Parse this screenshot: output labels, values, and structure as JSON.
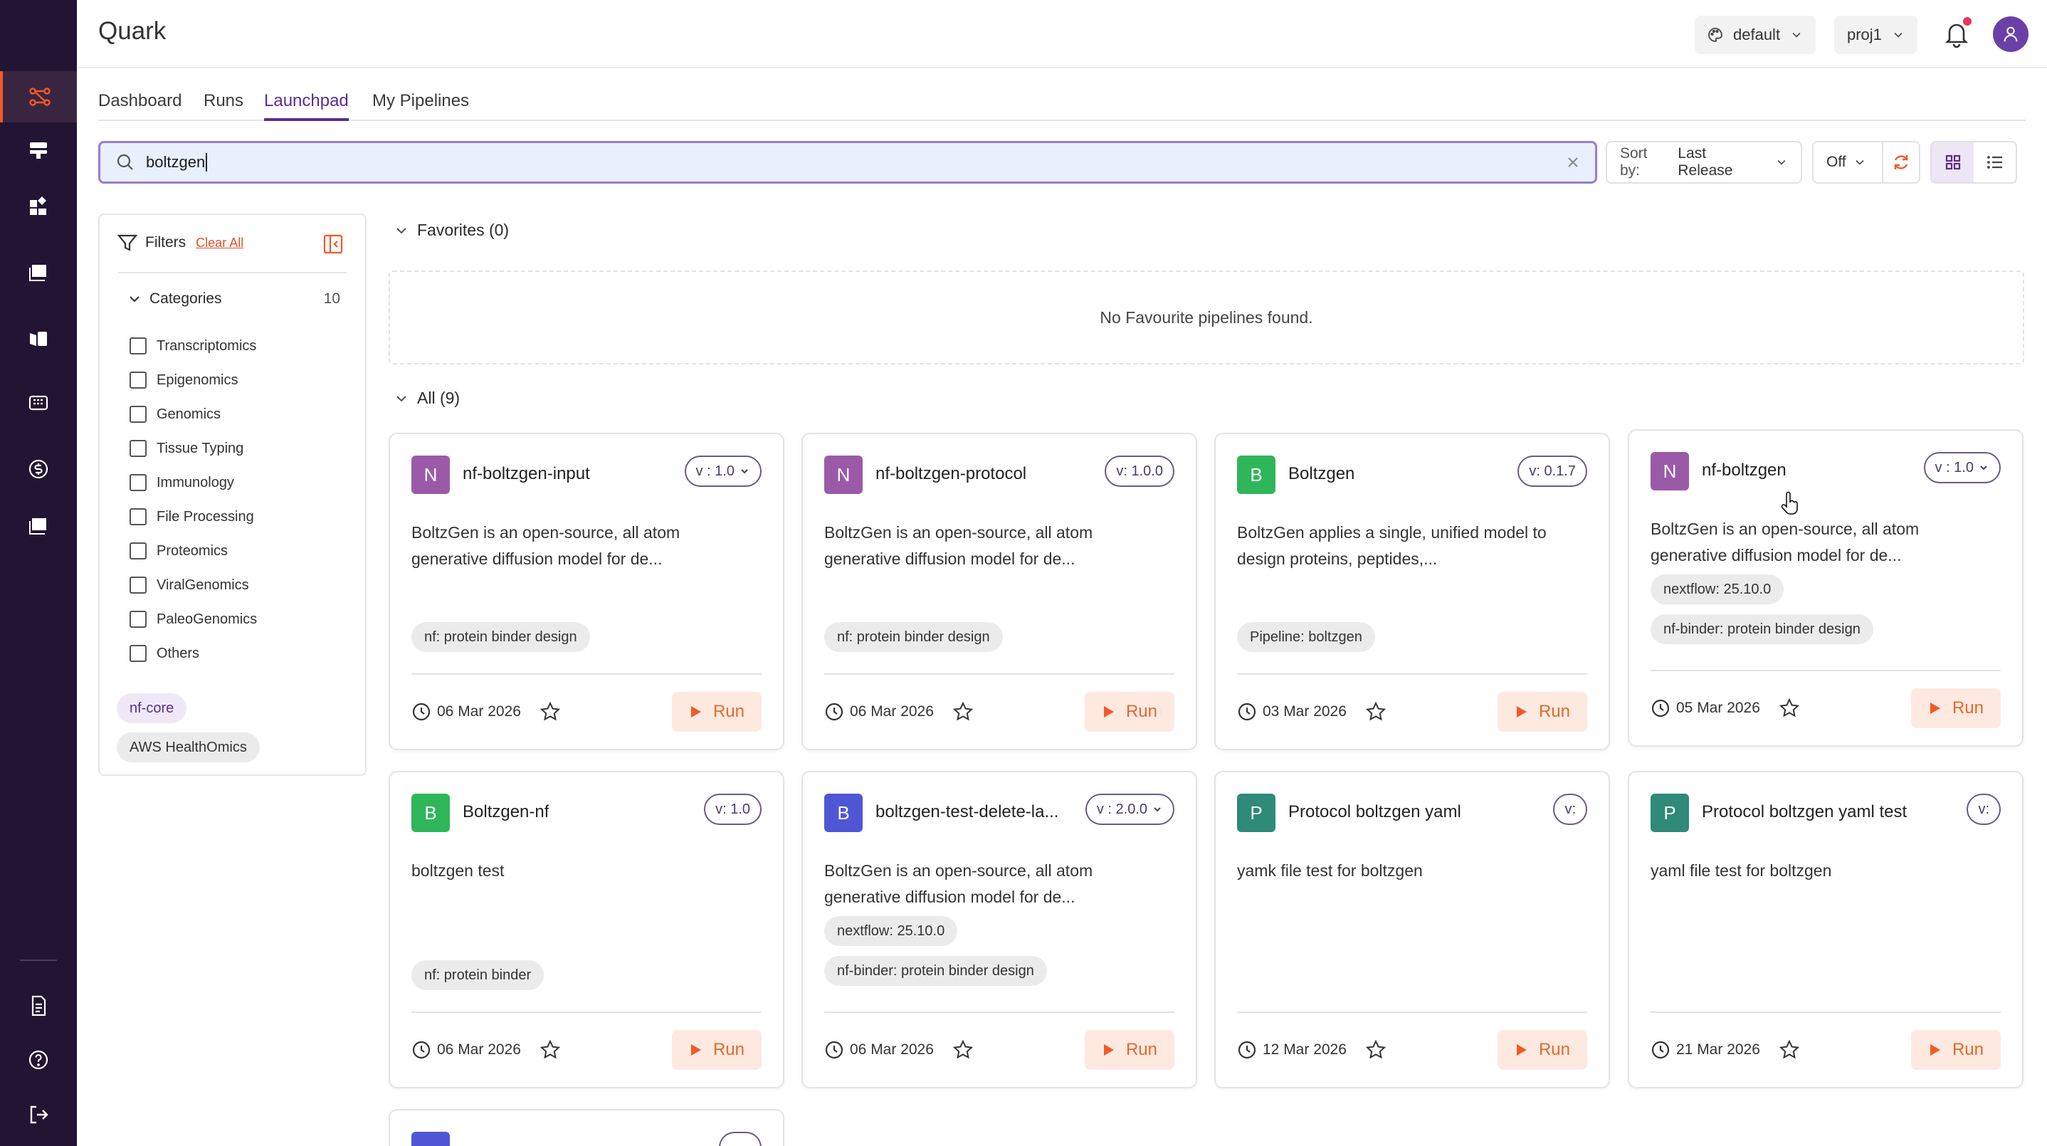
{
  "app": {
    "title": "Quark"
  },
  "header": {
    "env_label": "default",
    "project_label": "proj1"
  },
  "tabs": [
    {
      "label": "Dashboard"
    },
    {
      "label": "Runs"
    },
    {
      "label": "Launchpad",
      "active": true
    },
    {
      "label": "My Pipelines"
    }
  ],
  "search": {
    "value": "boltzgen"
  },
  "controls": {
    "sort_prefix": "Sort by:",
    "sort_value": "Last Release",
    "toggle_value": "Off"
  },
  "filters": {
    "title": "Filters",
    "clear_label": "Clear All",
    "categories_label": "Categories",
    "categories_count": "10",
    "categories": [
      "Transcriptomics",
      "Epigenomics",
      "Genomics",
      "Tissue Typing",
      "Immunology",
      "File Processing",
      "Proteomics",
      "ViralGenomics",
      "PaleoGenomics",
      "Others"
    ],
    "chips": [
      "nf-core",
      "AWS HealthOmics"
    ]
  },
  "favorites": {
    "heading": "Favorites (0)",
    "empty_text": "No Favourite pipelines found."
  },
  "all": {
    "heading": "All (9)"
  },
  "run_label": "Run",
  "cards": [
    {
      "letter": "N",
      "name": "nf-boltzgen-input",
      "version": "v : 1.0",
      "version_dropdown": true,
      "desc": "BoltzGen is an open-source, all atom generative diffusion model for de...",
      "tags": [
        "nf: protein binder design"
      ],
      "date": "06 Mar 2026",
      "badge_color": "#9b5aa8"
    },
    {
      "letter": "N",
      "name": "nf-boltzgen-protocol",
      "version": "v: 1.0.0",
      "version_dropdown": false,
      "desc": "BoltzGen is an open-source, all atom generative diffusion model for de...",
      "tags": [
        "nf: protein binder design"
      ],
      "date": "06 Mar 2026",
      "badge_color": "#9b5aa8"
    },
    {
      "letter": "B",
      "name": "Boltzgen",
      "version": "v: 0.1.7",
      "version_dropdown": false,
      "desc": "BoltzGen applies a single, unified model to design proteins, peptides,...",
      "tags": [
        "Pipeline: boltzgen"
      ],
      "date": "03 Mar 2026",
      "badge_color": "#2fb65a"
    },
    {
      "letter": "N",
      "name": "nf-boltzgen",
      "version": "v : 1.0",
      "version_dropdown": true,
      "desc": "BoltzGen is an open-source, all atom generative diffusion model for de...",
      "tags": [
        "nextflow: 25.10.0",
        "nf-binder: protein binder design"
      ],
      "date": "05 Mar 2026",
      "badge_color": "#9b5aa8"
    },
    {
      "letter": "B",
      "name": "Boltzgen-nf",
      "version": "v: 1.0",
      "version_dropdown": false,
      "desc": "boltzgen test",
      "tags": [
        "nf: protein binder"
      ],
      "date": "06 Mar 2026",
      "badge_color": "#2fb65a"
    },
    {
      "letter": "B",
      "name": "boltzgen-test-delete-la...",
      "version": "v : 2.0.0",
      "version_dropdown": true,
      "desc": "BoltzGen is an open-source, all atom generative diffusion model for de...",
      "tags": [
        "nextflow: 25.10.0",
        "nf-binder: protein binder design"
      ],
      "date": "06 Mar 2026",
      "badge_color": "#4f56d6"
    },
    {
      "letter": "P",
      "name": "Protocol boltzgen yaml",
      "version": "v:",
      "version_dropdown": false,
      "desc": "yamk file test for boltzgen",
      "tags": [],
      "date": "12 Mar 2026",
      "badge_color": "#2f8a78"
    },
    {
      "letter": "P",
      "name": "Protocol boltzgen yaml test",
      "version": "v:",
      "version_dropdown": false,
      "desc": "yaml file test for boltzgen",
      "tags": [],
      "date": "21 Mar 2026",
      "badge_color": "#2f8a78"
    }
  ],
  "colors": {
    "accent": "#5b2d8f",
    "rail": "#221533",
    "run": "#e06a2b"
  }
}
